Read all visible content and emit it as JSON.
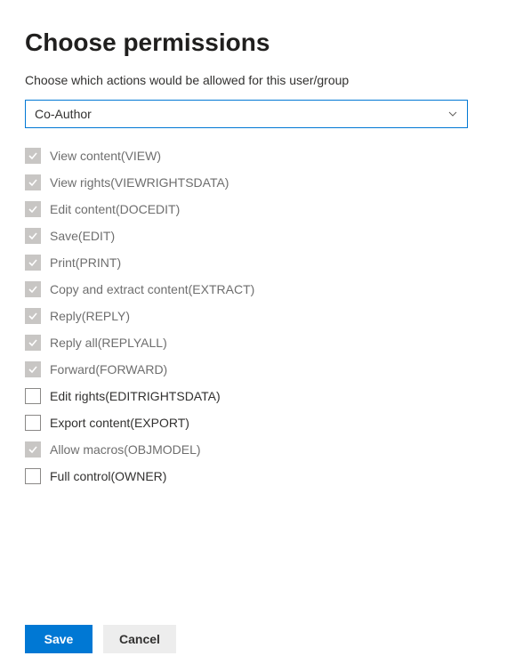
{
  "title": "Choose permissions",
  "subtitle": "Choose which actions would be allowed for this user/group",
  "dropdown": {
    "selected": "Co-Author"
  },
  "permissions": [
    {
      "label": "View content(VIEW)",
      "checked": true,
      "disabled": true
    },
    {
      "label": "View rights(VIEWRIGHTSDATA)",
      "checked": true,
      "disabled": true
    },
    {
      "label": "Edit content(DOCEDIT)",
      "checked": true,
      "disabled": true
    },
    {
      "label": "Save(EDIT)",
      "checked": true,
      "disabled": true
    },
    {
      "label": "Print(PRINT)",
      "checked": true,
      "disabled": true
    },
    {
      "label": "Copy and extract content(EXTRACT)",
      "checked": true,
      "disabled": true
    },
    {
      "label": "Reply(REPLY)",
      "checked": true,
      "disabled": true
    },
    {
      "label": "Reply all(REPLYALL)",
      "checked": true,
      "disabled": true
    },
    {
      "label": "Forward(FORWARD)",
      "checked": true,
      "disabled": true
    },
    {
      "label": "Edit rights(EDITRIGHTSDATA)",
      "checked": false,
      "disabled": false
    },
    {
      "label": "Export content(EXPORT)",
      "checked": false,
      "disabled": false
    },
    {
      "label": "Allow macros(OBJMODEL)",
      "checked": true,
      "disabled": true
    },
    {
      "label": "Full control(OWNER)",
      "checked": false,
      "disabled": false
    }
  ],
  "buttons": {
    "save": "Save",
    "cancel": "Cancel"
  }
}
